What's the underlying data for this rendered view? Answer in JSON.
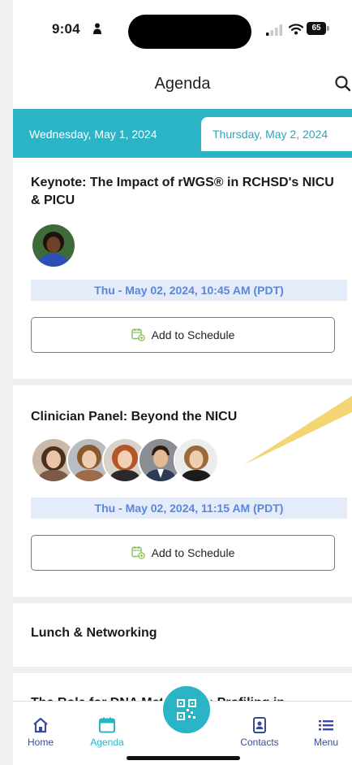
{
  "status_bar": {
    "time": "9:04",
    "battery": "65"
  },
  "header": {
    "title": "Agenda"
  },
  "date_tabs": [
    {
      "label": "Wednesday, May 1, 2024",
      "selected": false
    },
    {
      "label": "Thursday, May 2, 2024",
      "selected": true
    }
  ],
  "sessions": [
    {
      "title": "Keynote: The Impact of rWGS® in RCHSD's NICU & PICU",
      "speaker_count": 1,
      "time": "Thu - May 02, 2024, 10:45 AM (PDT)",
      "button_label": "Add to Schedule"
    },
    {
      "title": "Clinician Panel:  Beyond the NICU",
      "speaker_count": 5,
      "time": "Thu - May 02, 2024, 11:15 AM (PDT)",
      "button_label": "Add to Schedule"
    },
    {
      "title": "Lunch & Networking"
    },
    {
      "title": "The Role for DNA Methylation Profiling in"
    }
  ],
  "bottom_nav": {
    "items": [
      {
        "label": "Home",
        "icon": "home-icon"
      },
      {
        "label": "Agenda",
        "icon": "calendar-icon",
        "active": true
      },
      {
        "label": "",
        "icon": "qr-code-icon"
      },
      {
        "label": "Contacts",
        "icon": "contacts-icon"
      },
      {
        "label": "Menu",
        "icon": "menu-icon"
      }
    ]
  },
  "colors": {
    "accent": "#2bb3c6",
    "time_band_bg": "#e4ebf9",
    "time_band_text": "#5a86dc",
    "callout": "#f2d36b"
  }
}
